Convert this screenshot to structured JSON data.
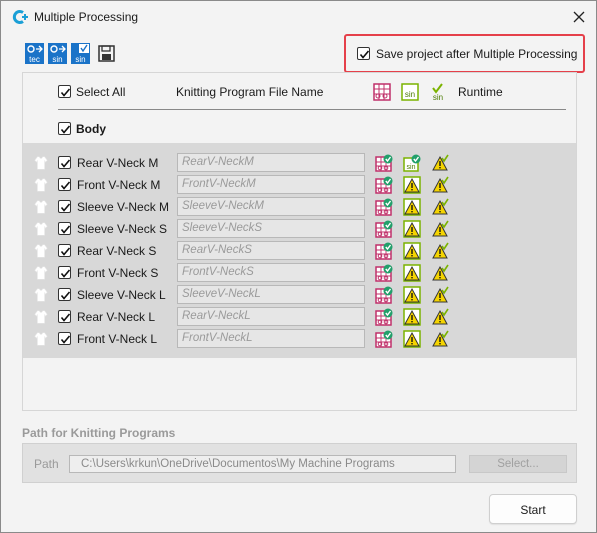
{
  "window": {
    "title": "Multiple Processing",
    "close_glyph": "✕"
  },
  "toolbar": {
    "icons": [
      "tec-settings-icon",
      "sin-settings-icon",
      "sin-check-icon",
      "save-disk-icon"
    ],
    "icon_labels": [
      "tec",
      "sin",
      "sin"
    ]
  },
  "save_project": {
    "label": "Save project after Multiple Processing",
    "checked": true
  },
  "header": {
    "select_all": "Select All",
    "file_name_col": "Knitting Program File Name",
    "runtime_col": "Runtime",
    "col_icons": [
      "knit-grid-icon",
      "sin-file-icon",
      "sin-check-icon"
    ],
    "col_icon_labels": [
      "sin",
      "sin"
    ]
  },
  "group": {
    "label": "Body"
  },
  "rows": [
    {
      "name": "Rear V-Neck M",
      "file": "RearV-NeckM",
      "sin_status": "ok"
    },
    {
      "name": "Front V-Neck M",
      "file": "FrontV-NeckM",
      "sin_status": "warn"
    },
    {
      "name": "Sleeve V-Neck M",
      "file": "SleeveV-NeckM",
      "sin_status": "warn"
    },
    {
      "name": "Sleeve V-Neck S",
      "file": "SleeveV-NeckS",
      "sin_status": "warn"
    },
    {
      "name": "Rear V-Neck S",
      "file": "RearV-NeckS",
      "sin_status": "warn"
    },
    {
      "name": "Front V-Neck S",
      "file": "FrontV-NeckS",
      "sin_status": "warn"
    },
    {
      "name": "Sleeve V-Neck L",
      "file": "SleeveV-NeckL",
      "sin_status": "warn"
    },
    {
      "name": "Rear V-Neck L",
      "file": "RearV-NeckL",
      "sin_status": "warn"
    },
    {
      "name": "Front V-Neck L",
      "file": "FrontV-NeckL",
      "sin_status": "warn"
    }
  ],
  "path": {
    "title": "Path for Knitting Programs",
    "label": "Path",
    "value": "C:\\Users\\krkun\\OneDrive\\Documentos\\My Machine Programs",
    "select_button": "Select..."
  },
  "actions": {
    "start": "Start"
  },
  "colors": {
    "highlight_border": "#e5404a",
    "knit_icon": "#c0306a",
    "check_green": "#22a06b",
    "warn_yellow": "#f5d400",
    "sin_green": "#7bb300",
    "toolbar_blue": "#1a73c8"
  }
}
